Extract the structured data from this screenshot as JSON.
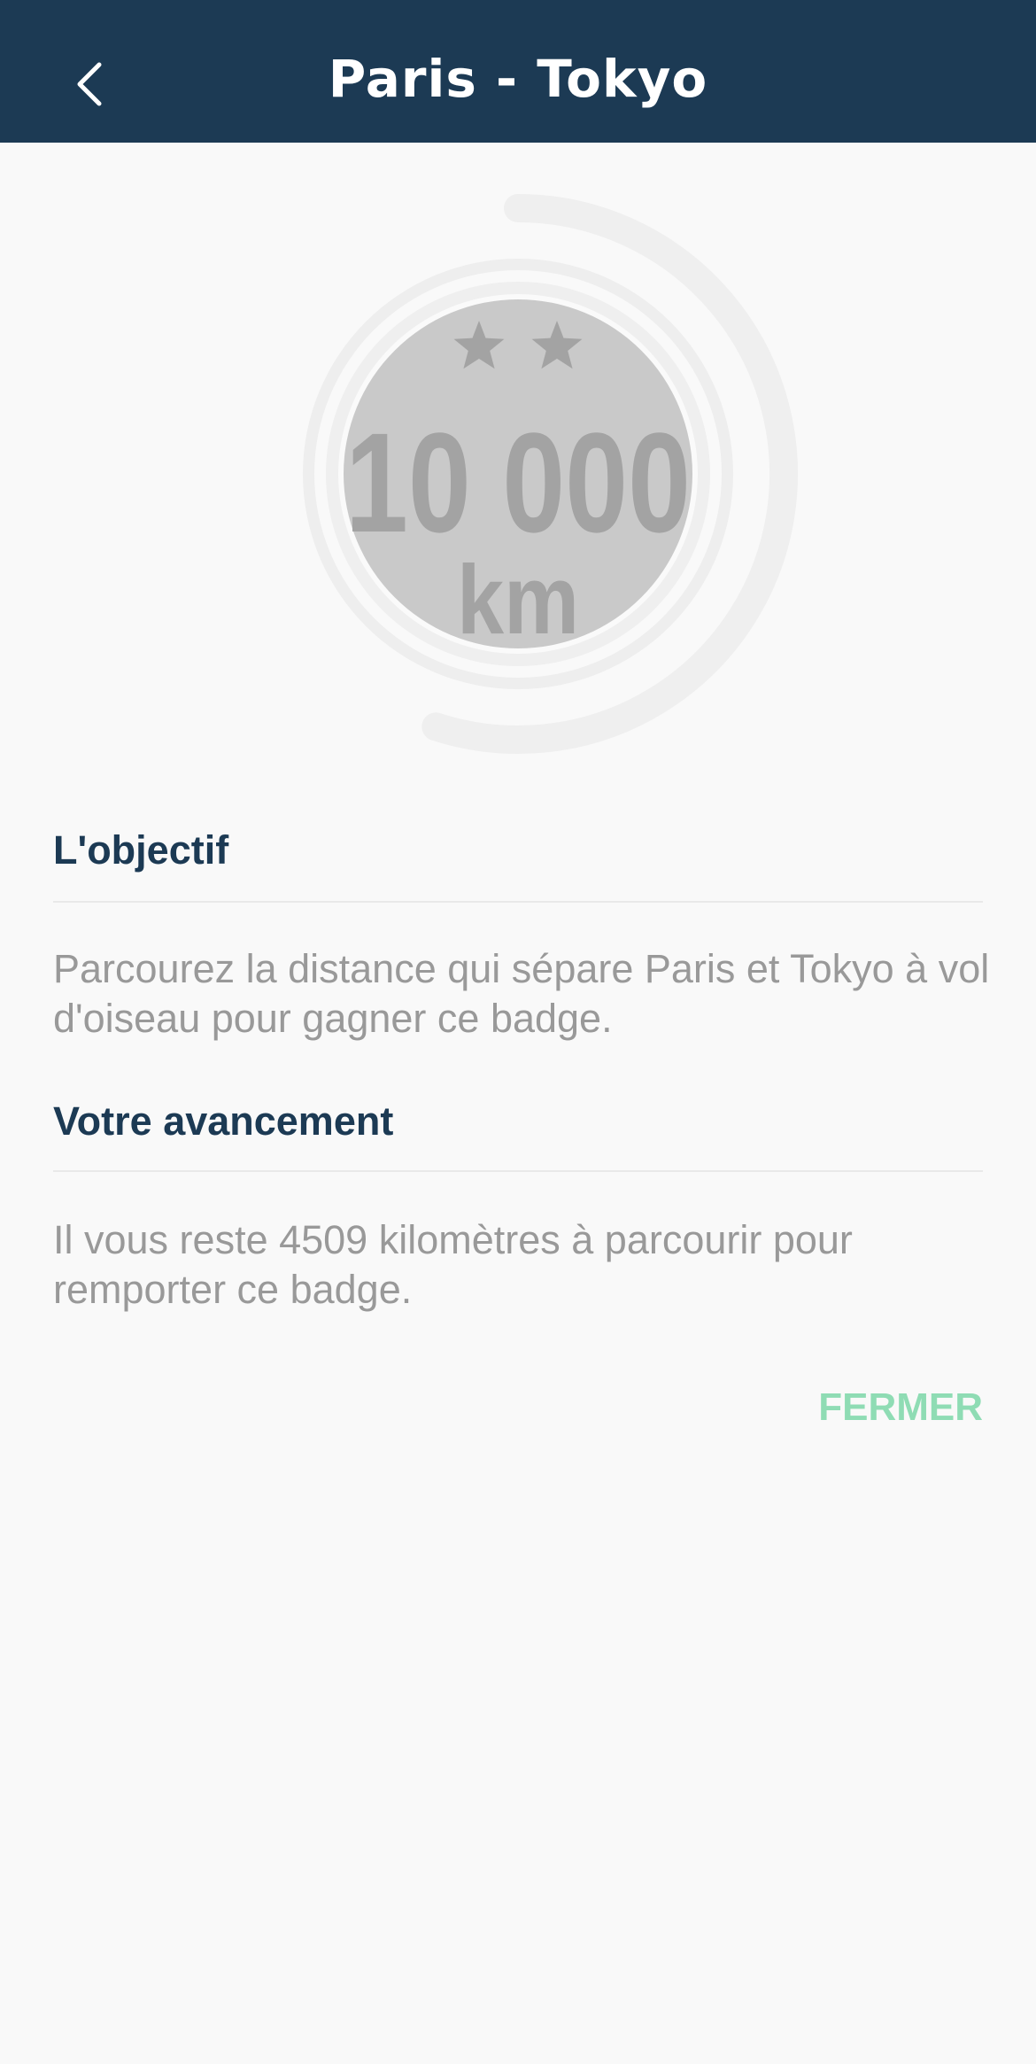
{
  "header": {
    "title": "Paris - Tokyo",
    "back_icon": "chevron-left-icon",
    "background_color": "#1c3a54"
  },
  "badge": {
    "value": "10 000",
    "unit": "km",
    "stars": 2,
    "star_icon": "star-icon",
    "progress_fraction": 0.55,
    "badge_color": "#c9c9c9",
    "text_color": "#a3a3a3"
  },
  "objective": {
    "heading": "L'objectif",
    "text": "Parcourez la distance qui sépare Paris et Tokyo à vol d'oiseau pour gagner ce badge."
  },
  "progress": {
    "heading": "Votre avancement",
    "text": "Il vous reste 4509 kilomètres à parcourir pour remporter ce badge."
  },
  "actions": {
    "close_label": "FERMER",
    "close_color": "#8fdcb4"
  }
}
